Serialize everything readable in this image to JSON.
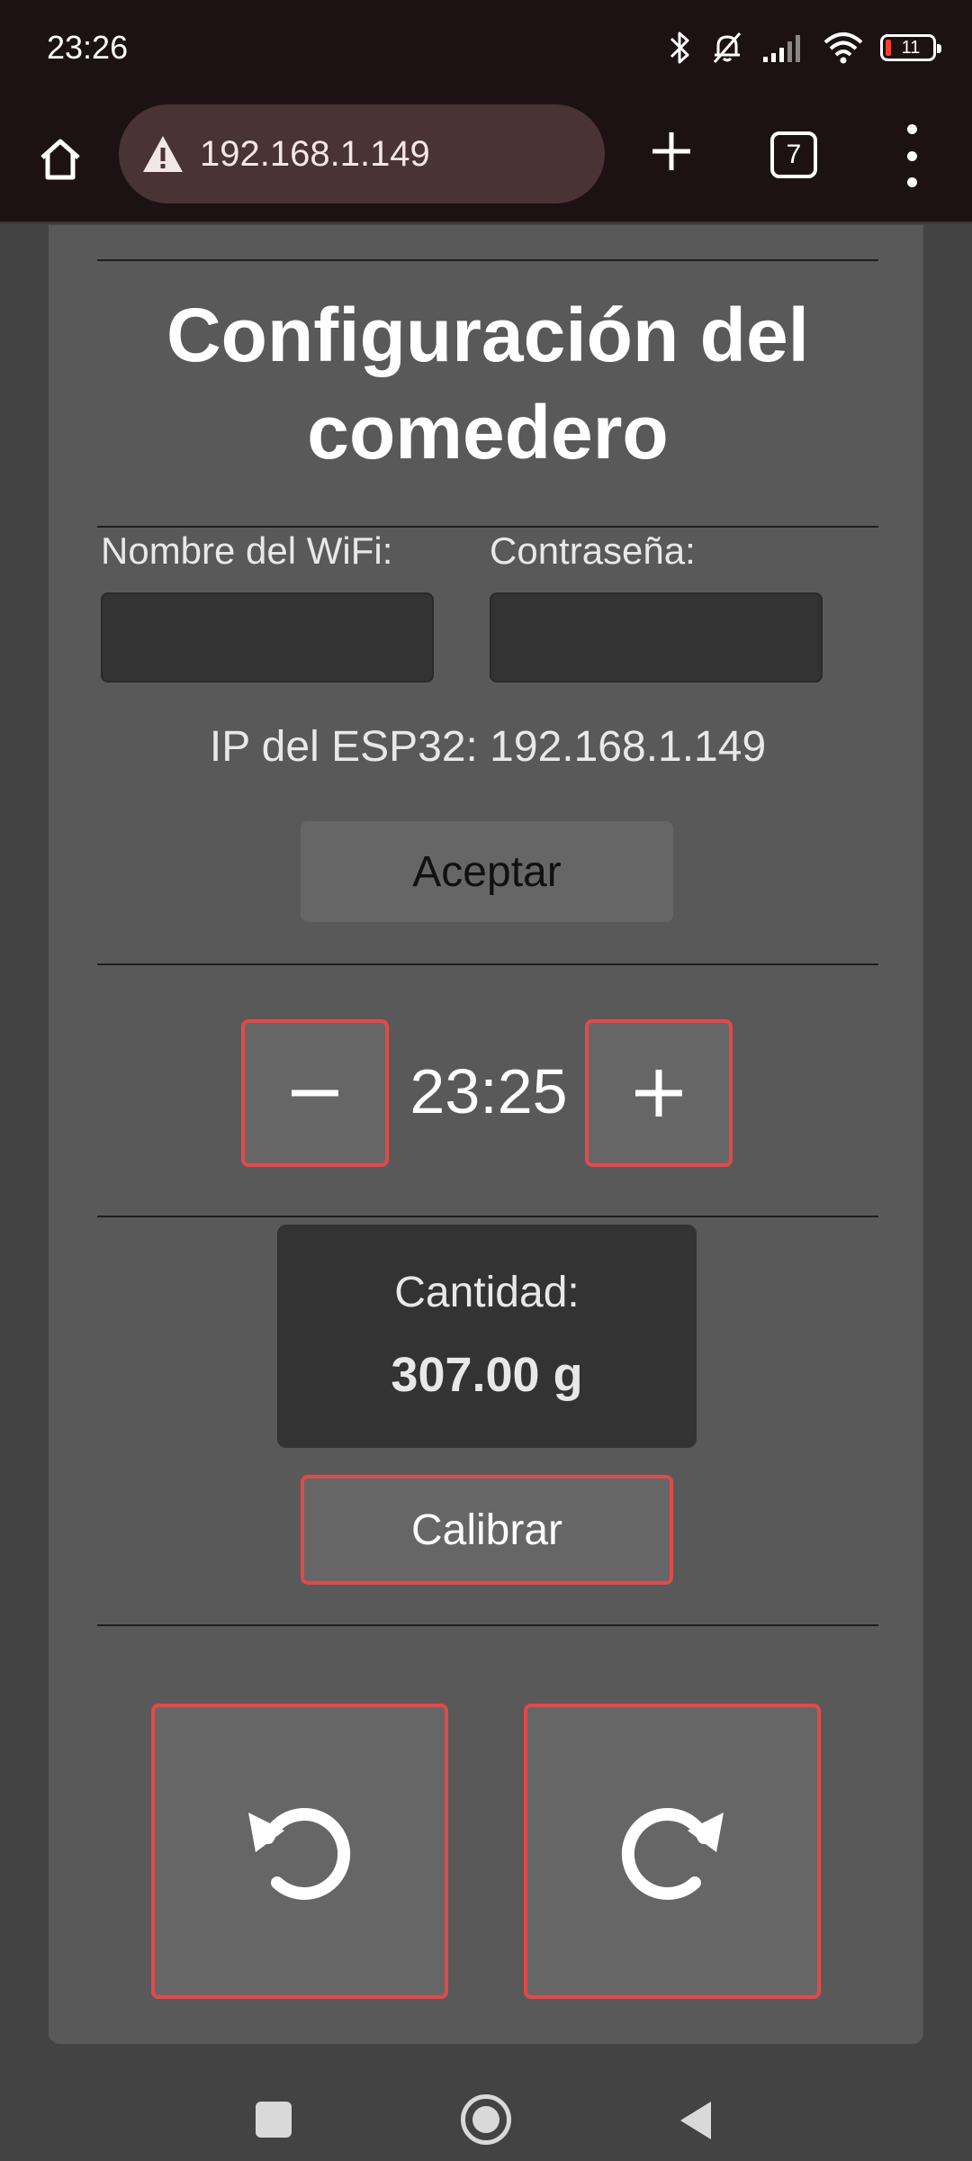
{
  "status_bar": {
    "time": "23:26",
    "battery_level": "11",
    "icons": [
      "bluetooth-icon",
      "bell-muted-icon",
      "signal-icon",
      "wifi-icon",
      "battery-icon"
    ]
  },
  "browser": {
    "url": "192.168.1.149",
    "tab_count": "7",
    "icons": [
      "home-icon",
      "warning-icon",
      "plus-icon",
      "tabs-icon",
      "more-vert-icon"
    ]
  },
  "page": {
    "title": "Configuración del comedero",
    "wifi": {
      "ssid_label": "Nombre del WiFi:",
      "ssid_value": "",
      "password_label": "Contraseña:",
      "password_value": ""
    },
    "ip_text": "IP del ESP32: 192.168.1.149",
    "accept_label": "Aceptar",
    "time_value": "23:25",
    "quantity_label": "Cantidad:",
    "quantity_value": "307.00 g",
    "calibrate_label": "Calibrar",
    "rotate_buttons": [
      "rotate-left-icon",
      "rotate-right-icon"
    ]
  },
  "colors": {
    "accent_border": "#e04a4a",
    "page_background": "#595959",
    "button_background": "#666666",
    "panel_dark": "#333333",
    "browser_bar": "#1c1214"
  },
  "nav_bar": {
    "icons": [
      "recents-icon",
      "home-circle-icon",
      "back-icon"
    ]
  }
}
